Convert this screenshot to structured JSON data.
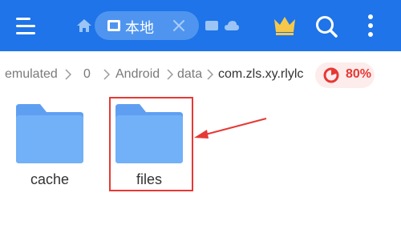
{
  "toolbar": {
    "tab_label": "本地"
  },
  "breadcrumb": {
    "items": [
      "emulated",
      "0",
      "Android",
      "data",
      "com.zls.xy.rlylc"
    ]
  },
  "storage_usage": "80%",
  "folders": [
    {
      "name": "cache"
    },
    {
      "name": "files"
    }
  ],
  "colors": {
    "toolbar": "#1e74e8",
    "folder": "#6aa8f7",
    "highlight": "#e53935"
  }
}
